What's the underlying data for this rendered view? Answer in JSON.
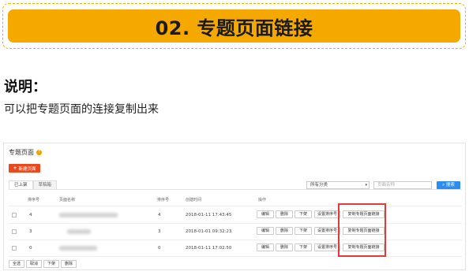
{
  "banner": {
    "title": "02. 专题页面链接"
  },
  "explain": {
    "heading": "说明：",
    "text": "可以把专题页面的连接复制出来"
  },
  "admin": {
    "page_title": "专题页面",
    "help_icon": "question-icon",
    "new_button": "新建页面",
    "tabs": [
      "已上架",
      "草稿箱"
    ],
    "filter_select": "所有分类",
    "filter_input_placeholder": "页面名称",
    "search_button": "搜索",
    "columns": [
      "排序号",
      "页面名称",
      "排序号",
      "创建时间",
      "操作"
    ],
    "rows": [
      {
        "order": "4",
        "order2": "4",
        "created": "2018-01-11 17:43:45"
      },
      {
        "order": "3",
        "order2": "3",
        "created": "2018-01-01 09:32:23"
      },
      {
        "order": "0",
        "order2": "0",
        "created": "2018-01-11 17:02:50"
      }
    ],
    "row_actions": [
      "编辑",
      "删除",
      "下架",
      "设置排序号",
      "复制专题页面链接"
    ],
    "bulk_actions": [
      "全选",
      "取消",
      "下架",
      "删除"
    ],
    "highlight_color": "#e23a3a",
    "accent_color": "#f5a800"
  }
}
